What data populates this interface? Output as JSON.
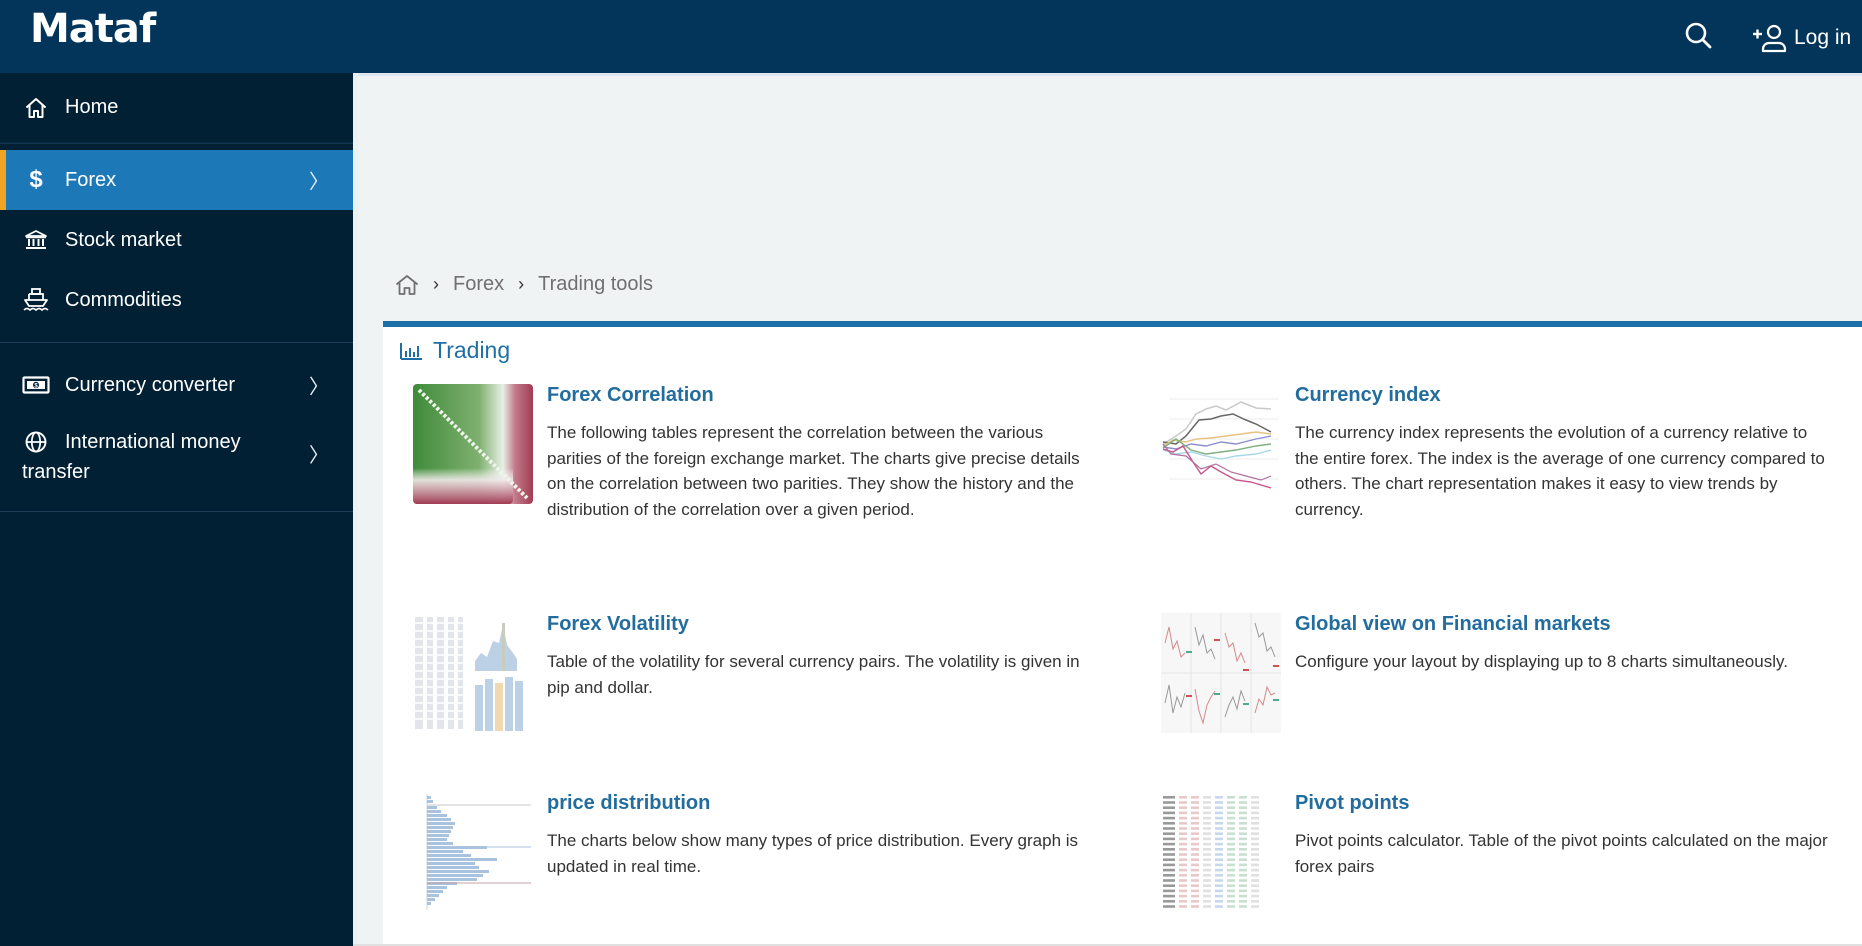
{
  "header": {
    "logo": "Mataf",
    "search_icon": "search-icon",
    "login_icon": "user-plus-icon",
    "login_label": "Log in"
  },
  "sidebar": {
    "items": [
      {
        "label": "Home",
        "icon": "home-icon",
        "has_chevron": false,
        "active": false
      },
      {
        "label": "Forex",
        "icon": "dollar-icon",
        "has_chevron": true,
        "active": true
      },
      {
        "label": "Stock market",
        "icon": "bank-building-icon",
        "has_chevron": false,
        "active": false
      },
      {
        "label": "Commodities",
        "icon": "ship-icon",
        "has_chevron": false,
        "active": false
      },
      {
        "label": "Currency converter",
        "icon": "banknote-icon",
        "has_chevron": true,
        "active": false
      },
      {
        "label": "International money transfer",
        "icon": "globe-icon",
        "has_chevron": true,
        "active": false
      }
    ],
    "chevron": "〉",
    "colors": {
      "background": "#022034",
      "active": "#1d78b8",
      "active_accent": "#f2a31f"
    }
  },
  "breadcrumb": {
    "home_icon": "home-icon",
    "separator": "›",
    "items": [
      "Forex",
      "Trading tools"
    ]
  },
  "section": {
    "title": "Trading",
    "icon": "bar-chart-icon",
    "accent_color": "#1d6fa8"
  },
  "cards": [
    {
      "title": "Forex Correlation",
      "thumbnail": "correlation-matrix-thumbnail",
      "description": "The following tables represent the correlation between the various parities of the foreign exchange market. The charts give precise details on the correlation between two parities. They show the history and the distribution of the correlation over a given period."
    },
    {
      "title": "Currency index",
      "thumbnail": "currency-index-chart-thumbnail",
      "description": "The currency index represents the evolution of a currency relative to the entire forex. The index is the average of one currency compared to others. The chart representation makes it easy to view trends by currency."
    },
    {
      "title": "Forex Volatility",
      "thumbnail": "volatility-table-thumbnail",
      "description": "Table of the volatility for several currency pairs. The volatility is given in pip and dollar."
    },
    {
      "title": "Global view on Financial markets",
      "thumbnail": "multi-chart-grid-thumbnail",
      "description": "Configure your layout by displaying up to 8 charts simultaneously."
    },
    {
      "title": "price distribution",
      "thumbnail": "price-histogram-thumbnail",
      "description": "The charts below show many types of price distribution. Every graph is updated in real time."
    },
    {
      "title": "Pivot points",
      "thumbnail": "pivot-table-thumbnail",
      "description": "Pivot points calculator. Table of the pivot points calculated on the major forex pairs"
    }
  ]
}
